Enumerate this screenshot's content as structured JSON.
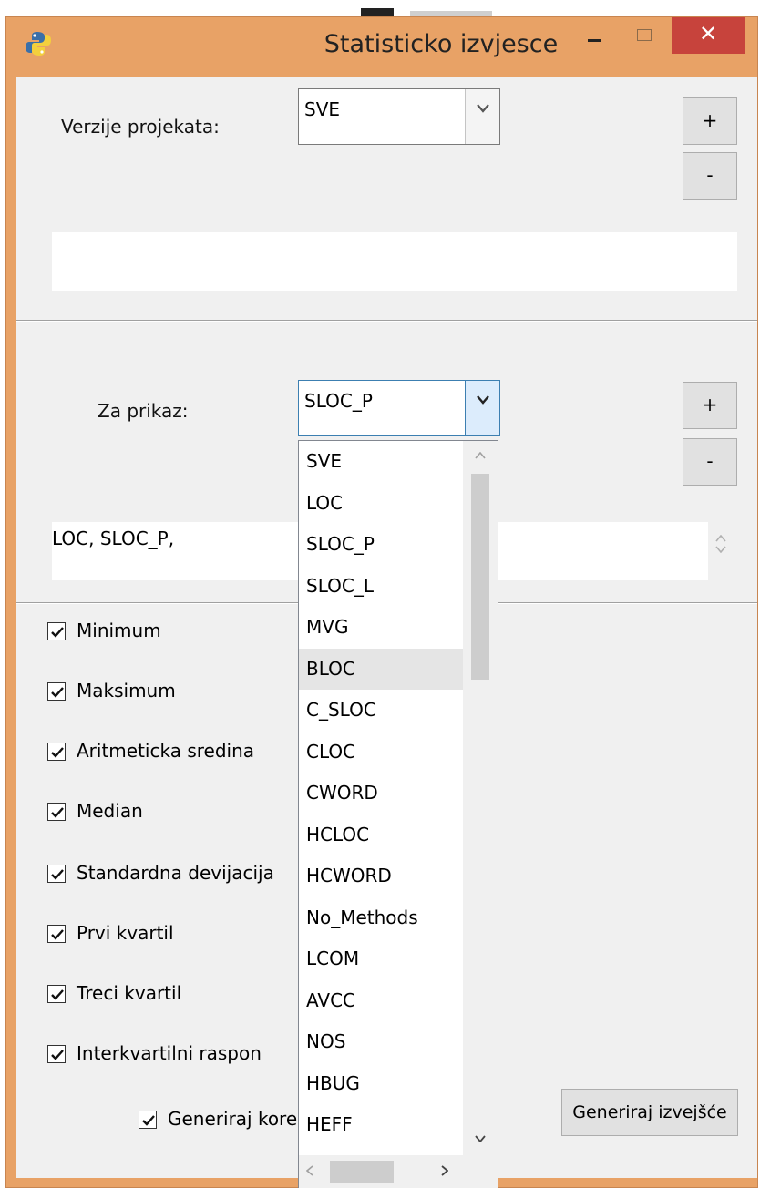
{
  "window": {
    "title": "Statisticko izvjesce"
  },
  "section1": {
    "label": "Verzije projekata:",
    "combo_value": "SVE",
    "add_label": "+",
    "remove_label": "-",
    "text_value": ""
  },
  "section2": {
    "label": "Za prikaz:",
    "combo_value": "SLOC_P",
    "add_label": "+",
    "remove_label": "-",
    "text_value": "LOC, SLOC_P,"
  },
  "dropdown": {
    "items": [
      "SVE",
      "LOC",
      "SLOC_P",
      "SLOC_L",
      "MVG",
      "BLOC",
      "C_SLOC",
      "CLOC",
      "CWORD",
      "HCLOC",
      "HCWORD",
      "No_Methods",
      "LCOM",
      "AVCC",
      "NOS",
      "HBUG",
      "HEFF"
    ],
    "hovered": "BLOC"
  },
  "statistics": [
    {
      "label": "Minimum",
      "checked": true
    },
    {
      "label": "Maksimum",
      "checked": true
    },
    {
      "label": "Aritmeticka sredina",
      "checked": true
    },
    {
      "label": "Median",
      "checked": true
    },
    {
      "label": "Standardna devijacija",
      "checked": true
    },
    {
      "label": "Prvi kvartil",
      "checked": true
    },
    {
      "label": "Treci kvartil",
      "checked": true
    },
    {
      "label": "Interkvartilni raspon",
      "checked": true
    }
  ],
  "correlation": {
    "label": "Generiraj kore",
    "checked": true
  },
  "generate_button": "Generiraj izvejšće",
  "colors": {
    "title_bar": "#e8a266",
    "close_button": "#c7433c",
    "client_bg": "#f0f0f0"
  }
}
